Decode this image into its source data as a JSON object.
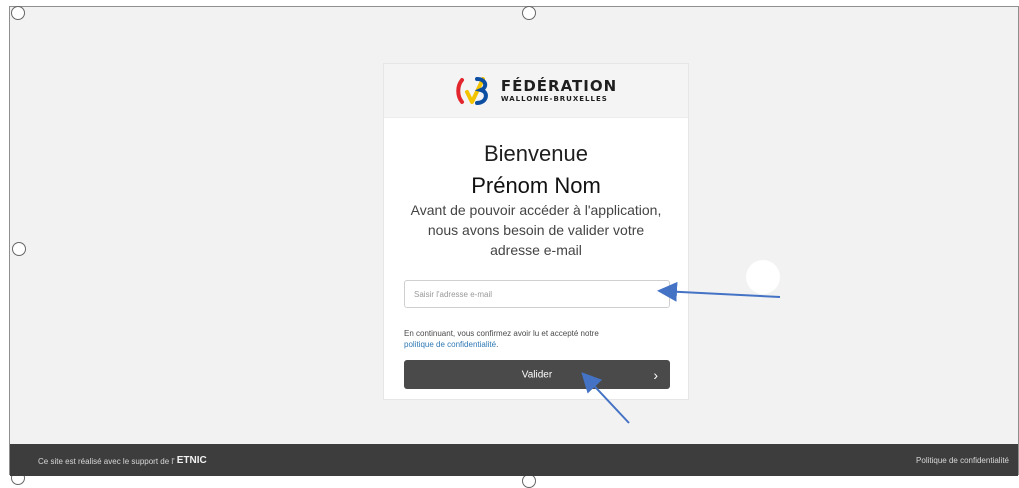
{
  "brand": {
    "main": "FÉDÉRATION",
    "sub": "WALLONIE-BRUXELLES"
  },
  "welcome": {
    "title": "Bienvenue",
    "name": "Prénom Nom",
    "message": "Avant de pouvoir accéder à l'application, nous avons besoin de valider votre adresse e-mail"
  },
  "form": {
    "email_placeholder": "Saisir l'adresse e-mail",
    "consent_prefix": "En continuant, vous confirmez avoir lu et accepté notre",
    "privacy_link": "politique de confidentialité",
    "consent_suffix": ".",
    "submit_label": "Valider",
    "submit_chevron": "›"
  },
  "footer": {
    "support_text": "Ce site est réalisé avec le support de l'",
    "support_brand": "ETNIC",
    "privacy_link": "Politique de confidentialité"
  },
  "colors": {
    "frame_bg": "#f2f2f2",
    "card_bg": "#ffffff",
    "brand_band_bg": "#f4f4f4",
    "button_bg": "#4a4a4a",
    "footer_bg": "#3d3d3d",
    "link_blue": "#2f79b5",
    "arrow_blue": "#4472c4",
    "logo_red": "#e3262d",
    "logo_yellow": "#f3c300",
    "logo_blue": "#0b4ea2"
  },
  "icons": {
    "logo": "federation-logo-icon",
    "chevron": "chevron-right-icon"
  }
}
